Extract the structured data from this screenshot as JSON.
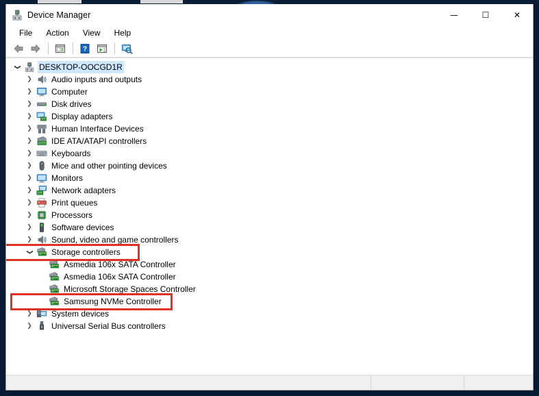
{
  "window": {
    "title": "Device Manager",
    "icon": "device-manager-icon",
    "controls": {
      "minimize": "—",
      "maximize": "☐",
      "close": "✕"
    }
  },
  "menu": {
    "items": [
      {
        "label": "File",
        "name": "menu-file"
      },
      {
        "label": "Action",
        "name": "menu-action"
      },
      {
        "label": "View",
        "name": "menu-view"
      },
      {
        "label": "Help",
        "name": "menu-help"
      }
    ]
  },
  "toolbar": {
    "buttons": [
      {
        "name": "back-button",
        "icon": "back-arrow-icon"
      },
      {
        "name": "forward-button",
        "icon": "forward-arrow-icon"
      },
      {
        "name": "properties-button",
        "icon": "properties-icon"
      },
      {
        "name": "help-button",
        "icon": "help-question-icon"
      },
      {
        "name": "update-driver-button",
        "icon": "update-driver-icon"
      },
      {
        "name": "scan-hardware-button",
        "icon": "scan-hardware-icon"
      }
    ]
  },
  "tree": {
    "root": {
      "label": "DESKTOP-OOCGD1R",
      "icon": "computer-root-icon",
      "expanded": true,
      "selected": true
    },
    "nodes": [
      {
        "label": "Audio inputs and outputs",
        "icon": "speaker-icon",
        "level": 1,
        "expandable": true,
        "expanded": false
      },
      {
        "label": "Computer",
        "icon": "monitor-icon",
        "level": 1,
        "expandable": true,
        "expanded": false
      },
      {
        "label": "Disk drives",
        "icon": "disk-drive-icon",
        "level": 1,
        "expandable": true,
        "expanded": false
      },
      {
        "label": "Display adapters",
        "icon": "display-adapter-icon",
        "level": 1,
        "expandable": true,
        "expanded": false
      },
      {
        "label": "Human Interface Devices",
        "icon": "gamepad-icon",
        "level": 1,
        "expandable": true,
        "expanded": false
      },
      {
        "label": "IDE ATA/ATAPI controllers",
        "icon": "ide-controller-icon",
        "level": 1,
        "expandable": true,
        "expanded": false
      },
      {
        "label": "Keyboards",
        "icon": "keyboard-icon",
        "level": 1,
        "expandable": true,
        "expanded": false
      },
      {
        "label": "Mice and other pointing devices",
        "icon": "mouse-icon",
        "level": 1,
        "expandable": true,
        "expanded": false
      },
      {
        "label": "Monitors",
        "icon": "monitor-screen-icon",
        "level": 1,
        "expandable": true,
        "expanded": false
      },
      {
        "label": "Network adapters",
        "icon": "network-adapter-icon",
        "level": 1,
        "expandable": true,
        "expanded": false
      },
      {
        "label": "Print queues",
        "icon": "printer-icon",
        "level": 1,
        "expandable": true,
        "expanded": false
      },
      {
        "label": "Processors",
        "icon": "processor-icon",
        "level": 1,
        "expandable": true,
        "expanded": false
      },
      {
        "label": "Software devices",
        "icon": "software-device-icon",
        "level": 1,
        "expandable": true,
        "expanded": false
      },
      {
        "label": "Sound, video and game controllers",
        "icon": "speaker-icon",
        "level": 1,
        "expandable": true,
        "expanded": false
      },
      {
        "label": "Storage controllers",
        "icon": "storage-controller-icon",
        "level": 1,
        "expandable": true,
        "expanded": true,
        "annotated": true
      },
      {
        "label": "Asmedia 106x SATA Controller",
        "icon": "storage-controller-icon",
        "level": 2,
        "expandable": false,
        "expanded": false
      },
      {
        "label": "Asmedia 106x SATA Controller",
        "icon": "storage-controller-icon",
        "level": 2,
        "expandable": false,
        "expanded": false
      },
      {
        "label": "Microsoft Storage Spaces Controller",
        "icon": "storage-controller-icon",
        "level": 2,
        "expandable": false,
        "expanded": false
      },
      {
        "label": "Samsung NVMe Controller",
        "icon": "storage-controller-icon",
        "level": 2,
        "expandable": false,
        "expanded": false,
        "annotated": true
      },
      {
        "label": "System devices",
        "icon": "system-device-icon",
        "level": 1,
        "expandable": true,
        "expanded": false
      },
      {
        "label": "Universal Serial Bus controllers",
        "icon": "usb-icon",
        "level": 1,
        "expandable": true,
        "expanded": false
      }
    ]
  },
  "status_bar": {
    "main_text": "",
    "pane2_text": "",
    "pane3_text": ""
  },
  "colors": {
    "annotation_red": "#e03127",
    "selection_blue": "#cde8ff",
    "desktop_navy": "#0b1d35",
    "status_bar_gray": "#f0f0f0"
  }
}
